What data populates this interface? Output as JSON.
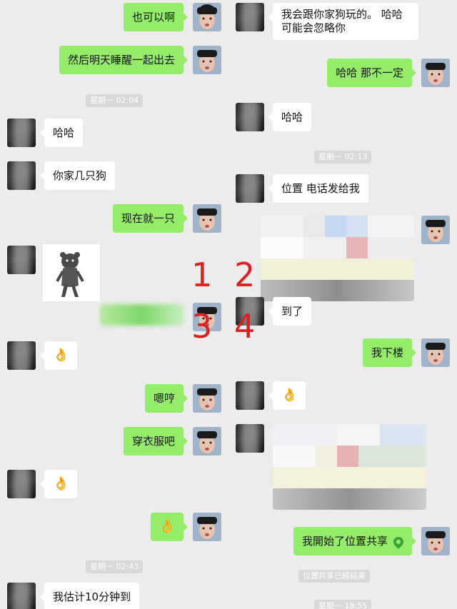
{
  "left": {
    "messages": [
      {
        "side": "out",
        "text": "也可以啊"
      },
      {
        "side": "out",
        "text": "然后明天睡醒一起出去"
      },
      {
        "side": "in",
        "text": "哈哈"
      },
      {
        "side": "in",
        "text": "你家几只狗"
      },
      {
        "side": "out",
        "text": "现在就一只"
      },
      {
        "side": "in",
        "text": "👌"
      },
      {
        "side": "out",
        "text": "嗯哼"
      },
      {
        "side": "out",
        "text": "穿衣服吧"
      },
      {
        "side": "in",
        "text": "👌"
      },
      {
        "side": "out",
        "text": "👌"
      },
      {
        "side": "in",
        "text": "我估计10分钟到"
      }
    ],
    "timestamps": [
      "星期一 02:04",
      "星期一 02:43"
    ]
  },
  "right": {
    "messages": [
      {
        "side": "in",
        "text": "我会跟你家狗玩的。 哈哈可能会忽略你"
      },
      {
        "side": "out",
        "text": "哈哈 那不一定"
      },
      {
        "side": "in",
        "text": "哈哈"
      },
      {
        "side": "in",
        "text": "位置 电话发给我"
      },
      {
        "side": "in",
        "text": "到了"
      },
      {
        "side": "out",
        "text": "我下楼"
      },
      {
        "side": "in",
        "text": "👌"
      },
      {
        "side": "out",
        "text": "我開始了位置共享"
      }
    ],
    "timestamps": [
      "星期一 02:13",
      "星期一 19:55"
    ],
    "system_notice": "位置共享已經結束"
  },
  "overlay_numbers": [
    "1",
    "2",
    "3",
    "4"
  ],
  "colors": {
    "background": "#ececec",
    "outgoing_bubble": "#95ec69",
    "incoming_bubble": "#ffffff",
    "timestamp_bg": "#d9d9d9",
    "overlay_number": "#e02020"
  }
}
